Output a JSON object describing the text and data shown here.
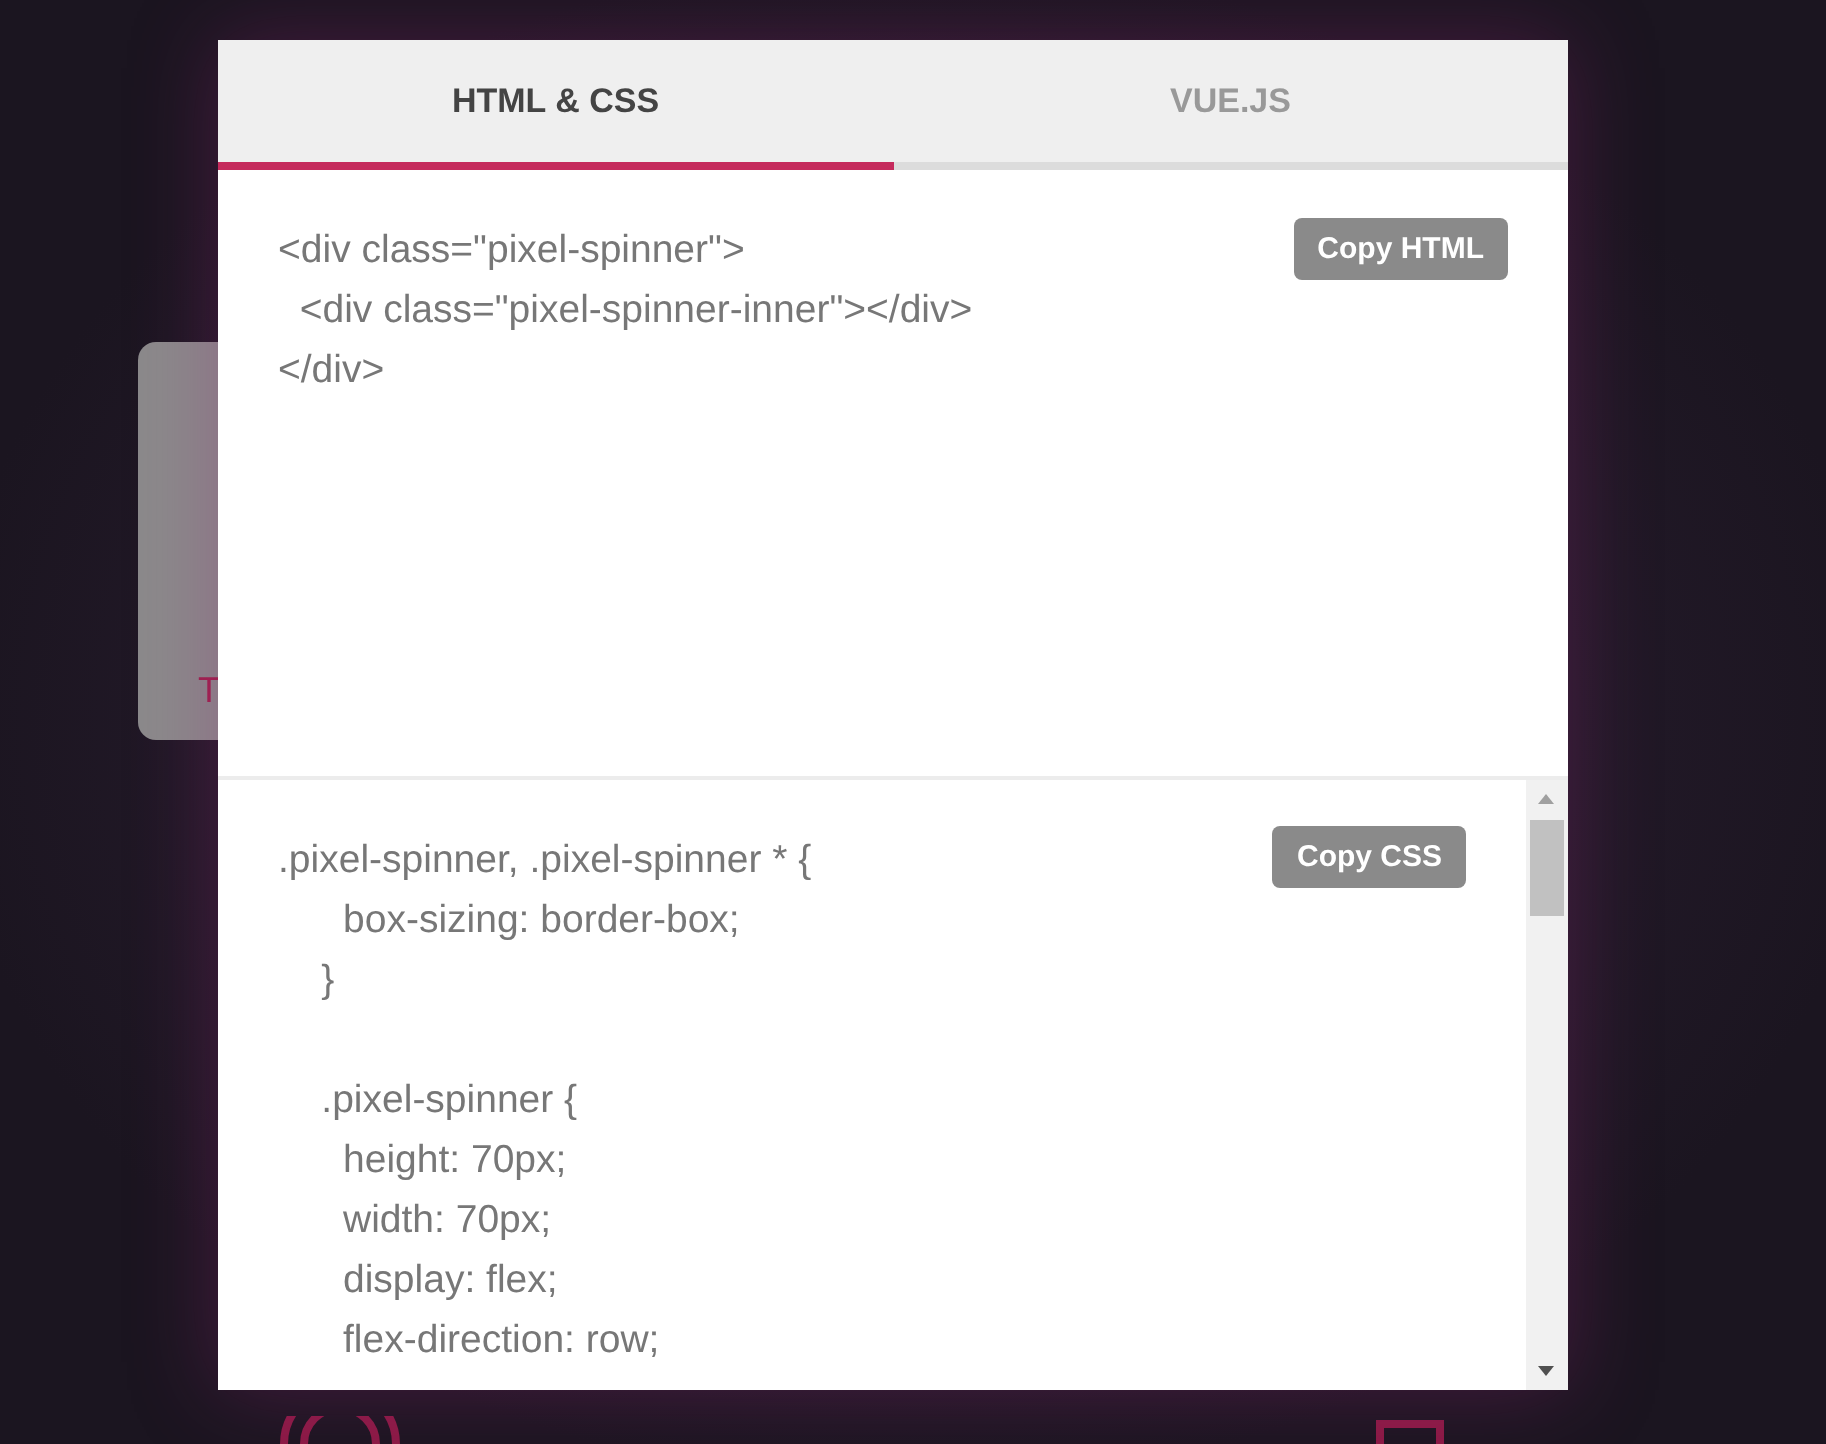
{
  "background": {
    "card_text": "T"
  },
  "tabs": [
    {
      "label": "HTML & CSS",
      "selected": true
    },
    {
      "label": "VUE.JS",
      "selected": false
    }
  ],
  "html_panel": {
    "copy_button": "Copy HTML",
    "code": [
      "<div class=\"pixel-spinner\">",
      "  <div class=\"pixel-spinner-inner\"></div>",
      "</div>"
    ]
  },
  "css_panel": {
    "copy_button": "Copy CSS",
    "code_blocks": [
      [
        ".pixel-spinner, .pixel-spinner * {",
        "      box-sizing: border-box;",
        "    }"
      ],
      [
        "    .pixel-spinner {",
        "      height: 70px;",
        "      width: 70px;",
        "      display: flex;",
        "      flex-direction: row;"
      ]
    ]
  }
}
